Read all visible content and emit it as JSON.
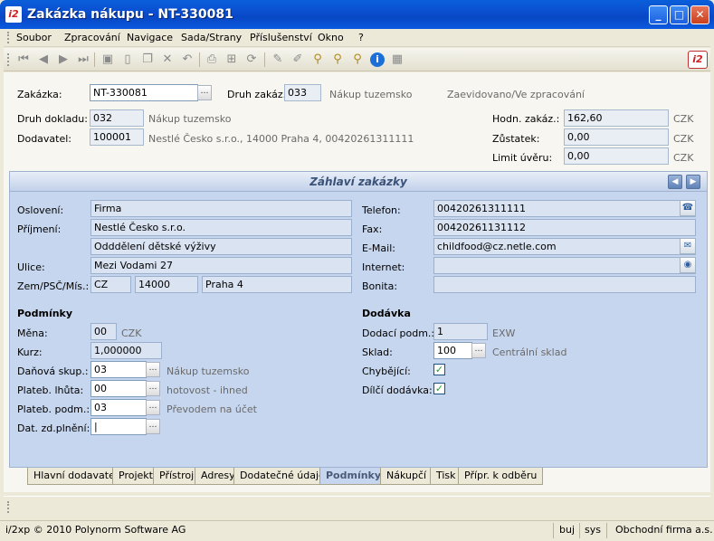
{
  "window": {
    "title": "Zakázka nákupu - NT-330081",
    "logo": "i2"
  },
  "menu": [
    "Soubor",
    "Zpracování",
    "Navigace",
    "Sada/Strany",
    "Příslušenství",
    "Okno",
    "?"
  ],
  "header": {
    "zakazka_label": "Zakázka:",
    "zakazka_value": "NT-330081",
    "druh_zakaz_label": "Druh zakáz.:",
    "druh_zakaz_value": "033",
    "druh_zakaz_desc": "Nákup tuzemsko",
    "status": "Zaevidovano/Ve zpracování",
    "druh_dokladu_label": "Druh dokladu:",
    "druh_dokladu_value": "032",
    "druh_dokladu_desc": "Nákup tuzemsko",
    "dodavatel_label": "Dodavatel:",
    "dodavatel_value": "100001",
    "dodavatel_desc": "Nestlé Česko s.r.o., 14000 Praha 4, 00420261311111",
    "hodn_label": "Hodn. zakáz.:",
    "hodn_value": "162,60",
    "hodn_cur": "CZK",
    "zustatek_label": "Zůstatek:",
    "zustatek_value": "0,00",
    "zustatek_cur": "CZK",
    "limit_label": "Limit úvěru:",
    "limit_value": "0,00",
    "limit_cur": "CZK"
  },
  "panel": {
    "title": "Záhlaví zakázky",
    "osloveni_label": "Oslovení:",
    "osloveni_value": "Firma",
    "prijmeni_label": "Příjmení:",
    "prijmeni_value": "Nestlé Česko s.r.o.",
    "prijmeni2_value": "Odddělení dětské výživy",
    "ulice_label": "Ulice:",
    "ulice_value": "Mezi Vodami 27",
    "zem_label": "Zem/PSČ/Mís.:",
    "zem_value": "CZ",
    "psc_value": "14000",
    "misto_value": "Praha 4",
    "telefon_label": "Telefon:",
    "telefon_value": "00420261311111",
    "fax_label": "Fax:",
    "fax_value": "00420261131112",
    "email_label": "E-Mail:",
    "email_value": "childfood@cz.netle.com",
    "internet_label": "Internet:",
    "internet_value": "",
    "bonita_label": "Bonita:",
    "bonita_value": "",
    "podminky_title": "Podmínky",
    "mena_label": "Měna:",
    "mena_value": "00",
    "mena_desc": "CZK",
    "kurz_label": "Kurz:",
    "kurz_value": "1,000000",
    "danova_label": "Daňová skup.:",
    "danova_value": "03",
    "danova_desc": "Nákup tuzemsko",
    "lhuta_label": "Plateb. lhůta:",
    "lhuta_value": "00",
    "lhuta_desc": "hotovost - ihned",
    "platpodm_label": "Plateb. podm.:",
    "platpodm_value": "03",
    "platpodm_desc": "Převodem na účet",
    "datzd_label": "Dat. zd.plnění:",
    "datzd_value": "|",
    "dodavka_title": "Dodávka",
    "dodaci_label": "Dodací podm.:",
    "dodaci_value": "1",
    "dodaci_desc": "EXW",
    "sklad_label": "Sklad:",
    "sklad_value": "100",
    "sklad_desc": "Centrální sklad",
    "chybejici_label": "Chybějící:",
    "chybejici_checked": true,
    "dilci_label": "Dílčí dodávka:",
    "dilci_checked": true
  },
  "tabs": [
    "Hlavní dodavatel",
    "Projekt",
    "Přístroj",
    "Adresy",
    "Dodatečné údaje",
    "Podmínky",
    "Nákupčí",
    "Tisk",
    "Přípr. k odběru"
  ],
  "active_tab": "Podmínky",
  "status": {
    "copyright": "i/2xp © 2010 Polynorm Software AG",
    "user": "buj",
    "db": "sys",
    "company": "Obchodní firma a.s."
  }
}
